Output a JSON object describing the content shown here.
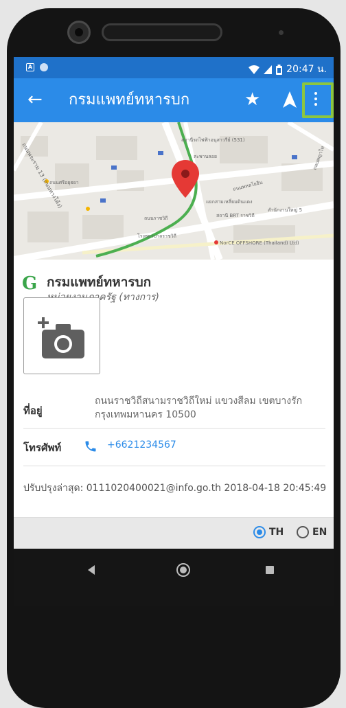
{
  "status_bar": {
    "time": "20:47 น.",
    "left_icons": [
      "notification-icon",
      "sync-icon"
    ],
    "right_icons": [
      "wifi-icon",
      "signal-icon",
      "battery-icon"
    ]
  },
  "app_bar": {
    "title": "กรมแพทย์ทหารบก",
    "back_icon": "arrow-left-icon",
    "actions": [
      "star-icon",
      "navigation-icon",
      "more-vert-icon"
    ]
  },
  "map": {
    "labels": [
      "ถนนพระราม 13 (ถนนทางโค้ง)",
      "สถานีรถไฟฟ้าอนุสาวรีย์ (531)",
      "สะพานลอย",
      "ถนนศรีอยุธยา",
      "ถนนราชวิถี",
      "ถนนพหลโยธิน",
      "แยกสามเหลี่ยมดินแดง",
      "สถานี BRT ราชวิถี",
      "สำนักงานใหญ่ 5",
      "ถนนพญาไท",
      "โรงพยาบาลราชวิถี",
      "NorCE OFFSHORE (Thailand) Ltd)"
    ]
  },
  "place": {
    "logo_letter": "G",
    "name": "กรมแพทย์ทหารบก",
    "type": "หน่วยงานภาครัฐ (ทางการ)"
  },
  "details": {
    "address_label": "ที่อยู่",
    "address_line1": "ถนนราชวิถีสนามราชวิถีใหม่ แขวงสีลม เขตบางรัก",
    "address_line2": "กรุงเทพมหานคร 10500",
    "phone_label": "โทรศัพท์",
    "phone": "+6621234567"
  },
  "last_updated": "ปรับปรุงล่าสุด: 0111020400021@info.go.th 2018-04-18 20:45:49",
  "language": {
    "options": [
      {
        "label": "TH",
        "selected": true
      },
      {
        "label": "EN",
        "selected": false
      }
    ]
  },
  "colors": {
    "status_bar": "#1f71c9",
    "app_bar": "#2b8be8",
    "highlight": "#8dc63f",
    "logo": "#3aa54a",
    "route": "#4caf50",
    "marker": "#e53935"
  }
}
